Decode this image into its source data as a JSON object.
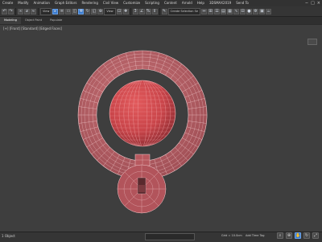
{
  "menubar": {
    "items": [
      "Create",
      "Modify",
      "Animation",
      "Graph Editors",
      "Rendering",
      "Civil View",
      "Customize",
      "Scripting",
      "Content",
      "Arnold",
      "Help",
      "3DSMAX2019",
      "Send To"
    ],
    "window_controls": [
      "−",
      "□",
      "×"
    ]
  },
  "toolbar": {
    "view_dropdown": "View",
    "selection_set": "Create Selection Se"
  },
  "ribbon": {
    "tabs": [
      "Modeling",
      "Object Paint",
      "Populate"
    ]
  },
  "viewport": {
    "label": "[+] [Front] [Standard] [Edged Faces]"
  },
  "statusbar": {
    "status_text": "1 Object",
    "grid_text": "Grid = 10.0cm",
    "key_label": "Add Time Tag"
  },
  "colors": {
    "mesh_fill": "#c4676e",
    "mesh_dark": "#a0484f",
    "wire": "#e8bcc0",
    "sphere": "#d14a4e",
    "accent": "#3c7ccf"
  }
}
